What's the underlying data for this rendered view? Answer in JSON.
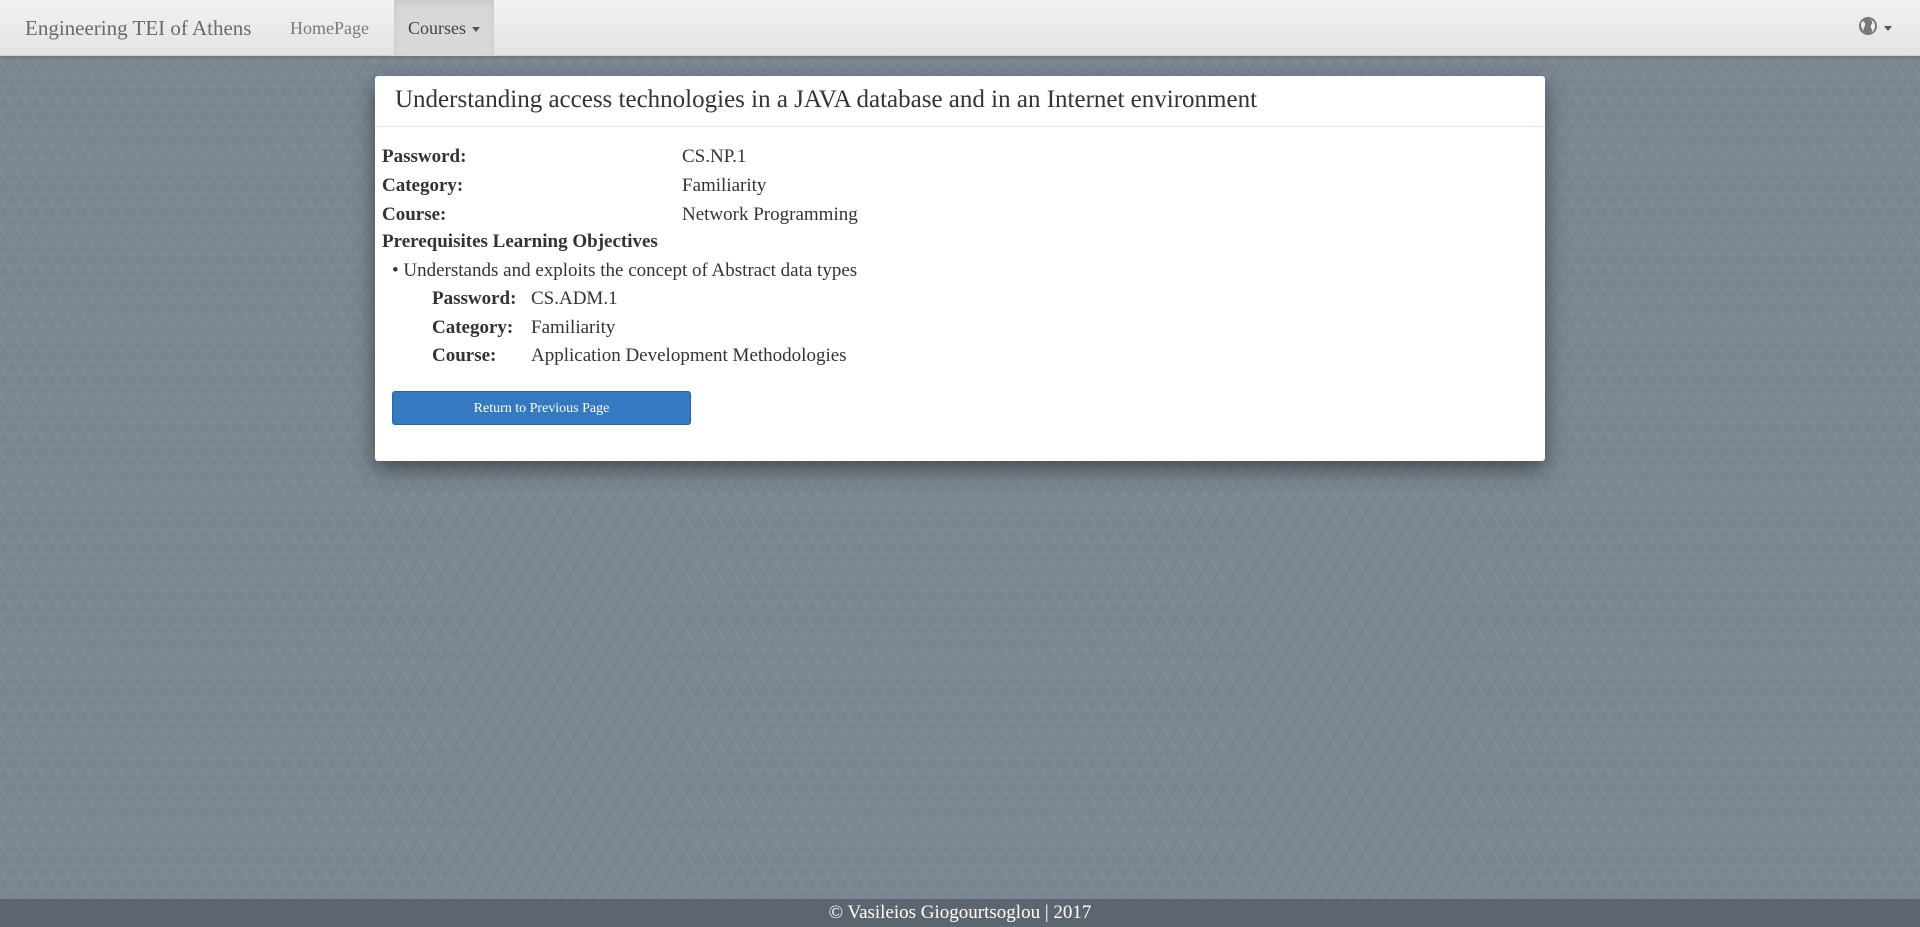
{
  "navbar": {
    "brand": "Engineering TEI of Athens",
    "items": [
      {
        "label": "HomePage"
      },
      {
        "label": "Courses"
      }
    ],
    "right_icon": "globe-icon"
  },
  "panel": {
    "title": "Understanding access technologies in a JAVA database and in an Internet environment",
    "fields": {
      "password_label": "Password:",
      "password_value": "CS.NP.1",
      "category_label": "Category:",
      "category_value": "Familiarity",
      "course_label": "Course:",
      "course_value": "Network Programming"
    },
    "prerequisites_heading": "Prerequisites Learning Objectives",
    "prerequisites": [
      {
        "objective": "• Understands and exploits the concept of Abstract data types",
        "password_label": "Password:",
        "password_value": "CS.ADM.1",
        "category_label": "Category:",
        "category_value": "Familiarity",
        "course_label": "Course:",
        "course_value": "Application Development Methodologies"
      }
    ],
    "return_button": "Return to Previous Page"
  },
  "footer": {
    "text": "© Vasileios Giogourtsoglou | 2017"
  },
  "colors": {
    "background": "#7a8792",
    "primary_button": "#3579c0",
    "footer": "#5d666f"
  }
}
